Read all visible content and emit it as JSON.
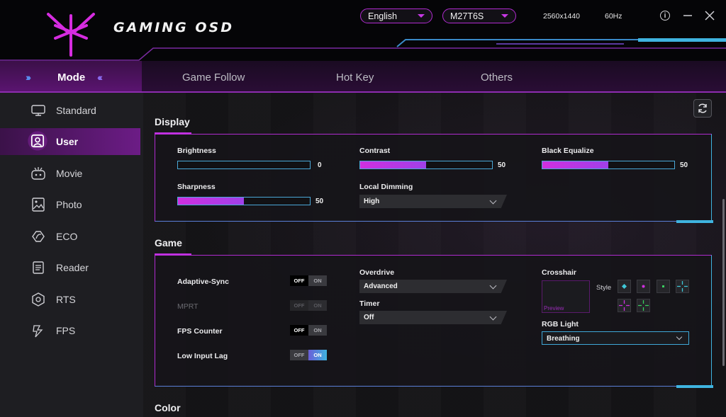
{
  "header": {
    "brand": "GAMING OSD",
    "language": "English",
    "model": "M27T6S",
    "resolution": "2560x1440",
    "refresh_rate": "60Hz",
    "accent_color": "#c030e0",
    "secondary_color": "#3fb4e0"
  },
  "tabs": [
    {
      "label": "Mode",
      "active": true
    },
    {
      "label": "Game Follow",
      "active": false
    },
    {
      "label": "Hot Key",
      "active": false
    },
    {
      "label": "Others",
      "active": false
    }
  ],
  "sidebar": {
    "items": [
      {
        "label": "Standard",
        "icon": "monitor-icon",
        "active": false
      },
      {
        "label": "User",
        "icon": "user-icon",
        "active": true
      },
      {
        "label": "Movie",
        "icon": "movie-icon",
        "active": false
      },
      {
        "label": "Photo",
        "icon": "photo-icon",
        "active": false
      },
      {
        "label": "ECO",
        "icon": "eco-icon",
        "active": false
      },
      {
        "label": "Reader",
        "icon": "reader-icon",
        "active": false
      },
      {
        "label": "RTS",
        "icon": "rts-icon",
        "active": false
      },
      {
        "label": "FPS",
        "icon": "fps-icon",
        "active": false
      }
    ]
  },
  "display": {
    "title": "Display",
    "brightness": {
      "label": "Brightness",
      "value": "0",
      "percent": 0
    },
    "contrast": {
      "label": "Contrast",
      "value": "50",
      "percent": 50
    },
    "black_equalize": {
      "label": "Black Equalize",
      "value": "50",
      "percent": 50
    },
    "sharpness": {
      "label": "Sharpness",
      "value": "50",
      "percent": 50
    },
    "local_dimming": {
      "label": "Local Dimming",
      "value": "High"
    }
  },
  "game": {
    "title": "Game",
    "adaptive_sync": {
      "label": "Adaptive-Sync",
      "off": "OFF",
      "on": "ON",
      "state": "off"
    },
    "mprt": {
      "label": "MPRT",
      "off": "OFF",
      "on": "ON",
      "state": "disabled"
    },
    "fps_counter": {
      "label": "FPS Counter",
      "off": "OFF",
      "on": "ON",
      "state": "off"
    },
    "low_input_lag": {
      "label": "Low Input Lag",
      "off": "OFF",
      "on": "ON",
      "state": "on"
    },
    "overdrive": {
      "label": "Overdrive",
      "value": "Advanced"
    },
    "timer": {
      "label": "Timer",
      "value": "Off"
    },
    "crosshair": {
      "label": "Crosshair",
      "preview": "Preview",
      "style_label": "Style"
    },
    "rgb_light": {
      "label": "RGB Light",
      "value": "Breathing"
    }
  },
  "color": {
    "title": "Color"
  }
}
